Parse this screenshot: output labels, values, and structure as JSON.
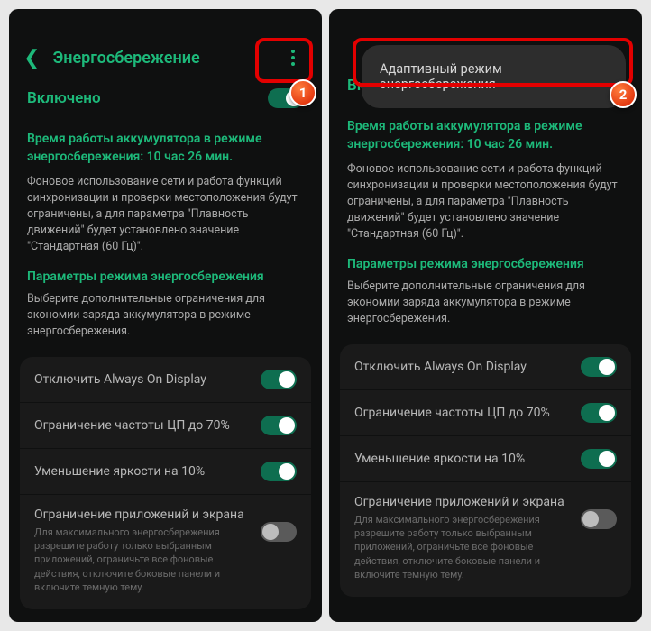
{
  "colors": {
    "accent": "#1db97a",
    "highlight": "#e30000"
  },
  "left": {
    "badge": "1",
    "header": {
      "title": "Энергосбережение"
    },
    "enabled": {
      "label": "Включено",
      "on": true
    },
    "runtime_heading": "Время работы аккумулятора в режиме энергосбережения: 10 час 26 мин.",
    "runtime_desc": "Фоновое использование сети и работа функций синхронизации и проверки местоположения будут ограничены, а для параметра \"Плавность движений\" будет установлено значение \"Стандартная (60 Гц)\".",
    "params_heading": "Параметры режима энергосбережения",
    "params_desc": "Выберите дополнительные ограничения для экономии заряда аккумулятора в режиме энергосбережения.",
    "options": [
      {
        "label": "Отключить Always On Display",
        "on": true
      },
      {
        "label": "Ограничение частоты ЦП до 70%",
        "on": true
      },
      {
        "label": "Уменьшение яркости на 10%",
        "on": true
      }
    ],
    "apps_limit": {
      "title": "Ограничение приложений и экрана",
      "sub": "Для максимального энергосбережения разрешите работу только выбранным приложений, ограничьте все фоновые действия, отключите боковые панели и включите темную тему.",
      "on": false
    }
  },
  "right": {
    "badge": "2",
    "menu_item": "Адаптивный режим энергосбережения",
    "enabled": {
      "label": "Включено",
      "on": true
    },
    "runtime_heading": "Время работы аккумулятора в режиме энергосбережения: 10 час 26 мин.",
    "runtime_desc": "Фоновое использование сети и работа функций синхронизации и проверки местоположения будут ограничены, а для параметра \"Плавность движений\" будет установлено значение \"Стандартная (60 Гц)\".",
    "params_heading": "Параметры режима энергосбережения",
    "params_desc": "Выберите дополнительные ограничения для экономии заряда аккумулятора в режиме энергосбережения.",
    "options": [
      {
        "label": "Отключить Always On Display",
        "on": true
      },
      {
        "label": "Ограничение частоты ЦП до 70%",
        "on": true
      },
      {
        "label": "Уменьшение яркости на 10%",
        "on": true
      }
    ],
    "apps_limit": {
      "title": "Ограничение приложений и экрана",
      "sub": "Для максимального энергосбережения разрешите работу только выбранным приложений, ограничьте все фоновые действия, отключите боковые панели и включите темную тему.",
      "on": false
    }
  }
}
